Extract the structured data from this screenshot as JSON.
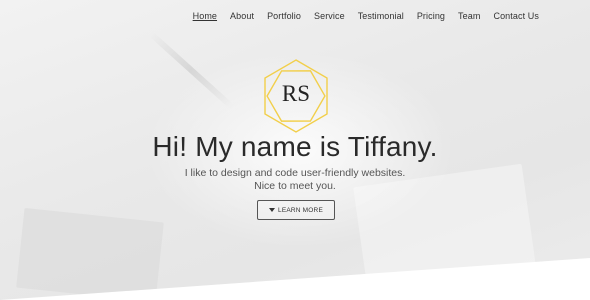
{
  "nav": {
    "items": [
      {
        "label": "Home",
        "active": true
      },
      {
        "label": "About"
      },
      {
        "label": "Portfolio"
      },
      {
        "label": "Service"
      },
      {
        "label": "Testimonial"
      },
      {
        "label": "Pricing"
      },
      {
        "label": "Team"
      },
      {
        "label": "Contact Us"
      }
    ]
  },
  "logo": {
    "text": "RS",
    "color": "#f2cf4a"
  },
  "hero": {
    "title": "Hi! My name is Tiffany.",
    "subtitle_line1": "I like to design and code user-friendly websites.",
    "subtitle_line2": "Nice to meet you.",
    "cta_label": "LEARN MORE",
    "cta_icon": "caret-down-icon"
  }
}
